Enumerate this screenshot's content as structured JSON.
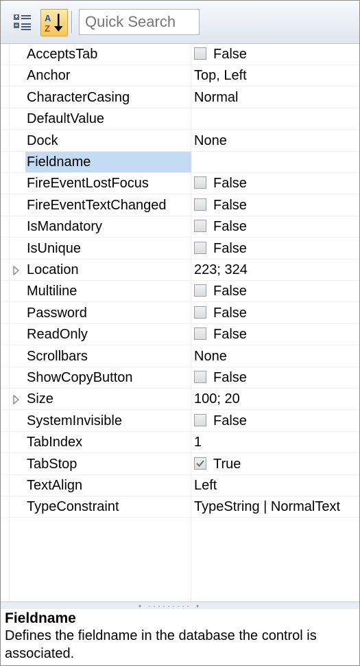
{
  "toolbar": {
    "search_placeholder": "Quick Search"
  },
  "properties": [
    {
      "name": "AcceptsTab",
      "value": "False",
      "checkbox": true,
      "checked": false
    },
    {
      "name": "Anchor",
      "value": "Top, Left"
    },
    {
      "name": "CharacterCasing",
      "value": "Normal"
    },
    {
      "name": "DefaultValue",
      "value": ""
    },
    {
      "name": "Dock",
      "value": "None"
    },
    {
      "name": "Fieldname",
      "value": "",
      "selected": true
    },
    {
      "name": "FireEventLostFocus",
      "value": "False",
      "checkbox": true,
      "checked": false
    },
    {
      "name": "FireEventTextChanged",
      "value": "False",
      "checkbox": true,
      "checked": false
    },
    {
      "name": "IsMandatory",
      "value": "False",
      "checkbox": true,
      "checked": false
    },
    {
      "name": "IsUnique",
      "value": "False",
      "checkbox": true,
      "checked": false
    },
    {
      "name": "Location",
      "value": "223; 324",
      "expandable": true
    },
    {
      "name": "Multiline",
      "value": "False",
      "checkbox": true,
      "checked": false
    },
    {
      "name": "Password",
      "value": "False",
      "checkbox": true,
      "checked": false
    },
    {
      "name": "ReadOnly",
      "value": "False",
      "checkbox": true,
      "checked": false
    },
    {
      "name": "Scrollbars",
      "value": "None"
    },
    {
      "name": "ShowCopyButton",
      "value": "False",
      "checkbox": true,
      "checked": false
    },
    {
      "name": "Size",
      "value": "100; 20",
      "expandable": true
    },
    {
      "name": "SystemInvisible",
      "value": "False",
      "checkbox": true,
      "checked": false
    },
    {
      "name": "TabIndex",
      "value": "1"
    },
    {
      "name": "TabStop",
      "value": "True",
      "checkbox": true,
      "checked": true
    },
    {
      "name": "TextAlign",
      "value": "Left"
    },
    {
      "name": "TypeConstraint",
      "value": "TypeString | NormalText"
    }
  ],
  "splitter": {
    "grip": "▾ ········· ▾"
  },
  "description": {
    "title": "Fieldname",
    "text": "Defines the fieldname in the database the control is associated."
  }
}
